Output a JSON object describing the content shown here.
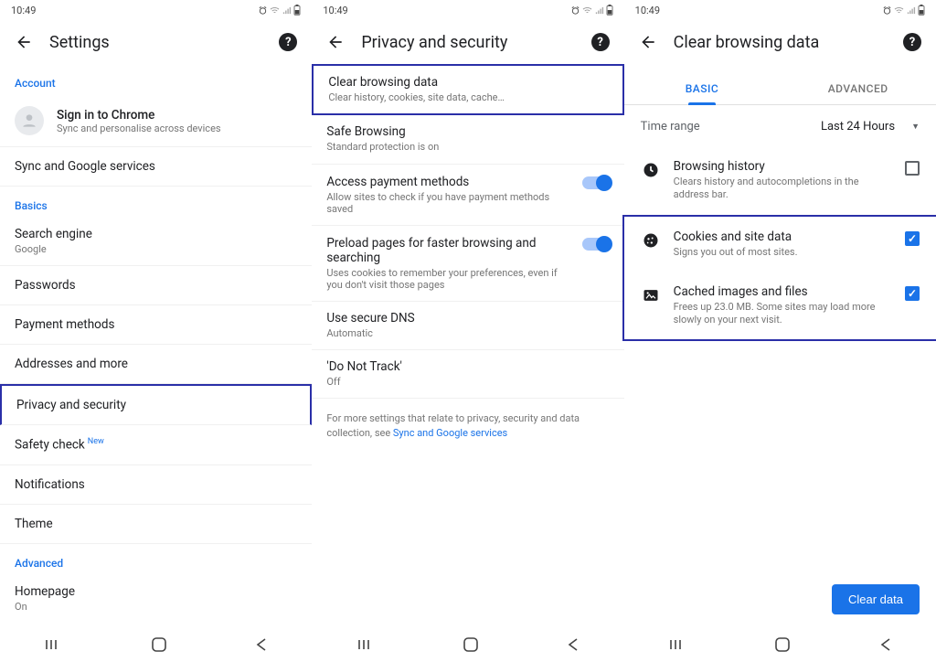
{
  "common": {
    "time": "10:49"
  },
  "panel1": {
    "title": "Settings",
    "account_label": "Account",
    "signin": {
      "primary": "Sign in to Chrome",
      "secondary": "Sync and personalise across devices"
    },
    "sync": "Sync and Google services",
    "basics_label": "Basics",
    "search": {
      "primary": "Search engine",
      "secondary": "Google"
    },
    "passwords": "Passwords",
    "payment": "Payment methods",
    "addresses": "Addresses and more",
    "privacy": "Privacy and security",
    "safety": "Safety check",
    "safety_badge": "New",
    "notifications": "Notifications",
    "theme": "Theme",
    "advanced_label": "Advanced",
    "homepage": {
      "primary": "Homepage",
      "secondary": "On"
    }
  },
  "panel2": {
    "title": "Privacy and security",
    "clear": {
      "primary": "Clear browsing data",
      "secondary": "Clear history, cookies, site data, cache…"
    },
    "safe": {
      "primary": "Safe Browsing",
      "secondary": "Standard protection is on"
    },
    "payments": {
      "primary": "Access payment methods",
      "secondary": "Allow sites to check if you have payment methods saved"
    },
    "preload": {
      "primary": "Preload pages for faster browsing and searching",
      "secondary": "Uses cookies to remember your preferences, even if you don't visit those pages"
    },
    "dns": {
      "primary": "Use secure DNS",
      "secondary": "Automatic"
    },
    "dnt": {
      "primary": "'Do Not Track'",
      "secondary": "Off"
    },
    "footnote_a": "For more settings that relate to privacy, security and data collection, see ",
    "footnote_link": "Sync and Google services"
  },
  "panel3": {
    "title": "Clear browsing data",
    "tab_basic": "BASIC",
    "tab_advanced": "ADVANCED",
    "timerange_label": "Time range",
    "timerange_value": "Last 24 Hours",
    "history": {
      "primary": "Browsing history",
      "secondary": "Clears history and autocompletions in the address bar."
    },
    "cookies": {
      "primary": "Cookies and site data",
      "secondary": "Signs you out of most sites."
    },
    "cache": {
      "primary": "Cached images and files",
      "secondary": "Frees up 23.0 MB. Some sites may load more slowly on your next visit."
    },
    "clear_button": "Clear data"
  }
}
